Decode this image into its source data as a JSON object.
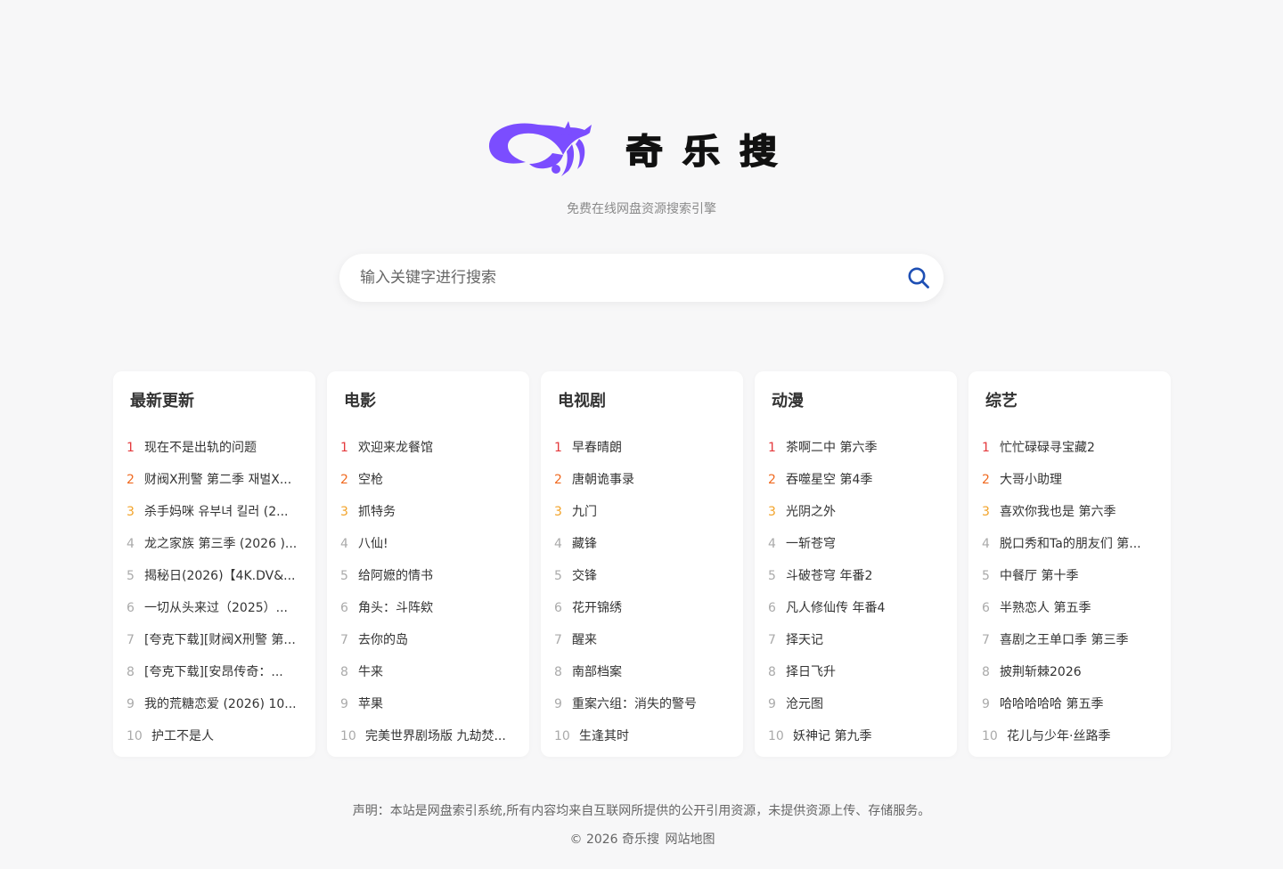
{
  "brand": {
    "name": "奇乐搜",
    "tagline": "免费在线网盘资源搜索引擎",
    "accent_color": "#7b4dff"
  },
  "search": {
    "placeholder": "输入关键字进行搜索",
    "value": "",
    "icon": "search-icon",
    "icon_color": "#1e4fb4"
  },
  "rank_colors": [
    "#e4393c",
    "#f06a20",
    "#f2a329"
  ],
  "sections": [
    {
      "title": "最新更新",
      "items": [
        "现在不是出轨的问题",
        "财阀X刑警 第二季 재벌X...",
        "杀手妈咪 유부녀 킬러 (2...",
        "龙之家族 第三季 (2026 )...",
        "揭秘日(2026)【4K.DV&...",
        "一切从头来过（2025）...",
        "[夸克下载][财阀X刑警 第...",
        "[夸克下载][安昂传奇：...",
        "我的荒糖恋爱 (2026) 10...",
        "护工不是人"
      ]
    },
    {
      "title": "电影",
      "items": [
        "欢迎来龙餐馆",
        "空枪",
        "抓特务",
        "八仙!",
        "给阿嬷的情书",
        "角头：斗阵欸",
        "去你的岛",
        "牛来",
        "苹果",
        "完美世界剧场版 九劫焚..."
      ]
    },
    {
      "title": "电视剧",
      "items": [
        "早春晴朗",
        "唐朝诡事录",
        "九门",
        "藏锋",
        "交锋",
        "花开锦绣",
        "醒来",
        "南部档案",
        "重案六组：消失的警号",
        "生逢其时"
      ]
    },
    {
      "title": "动漫",
      "items": [
        "茶啊二中 第六季",
        "吞噬星空 第4季",
        "光阴之外",
        "一斩苍穹",
        "斗破苍穹 年番2",
        "凡人修仙传 年番4",
        "择天记",
        "择日飞升",
        "沧元图",
        "妖神记 第九季"
      ]
    },
    {
      "title": "综艺",
      "items": [
        "忙忙碌碌寻宝藏2",
        "大哥小助理",
        "喜欢你我也是 第六季",
        "脱口秀和Ta的朋友们 第...",
        "中餐厅 第十季",
        "半熟恋人 第五季",
        "喜剧之王单口季 第三季",
        "披荆斩棘2026",
        "哈哈哈哈哈 第五季",
        "花儿与少年·丝路季"
      ]
    }
  ],
  "footer": {
    "disclaimer": "声明：本站是网盘索引系统,所有内容均来自互联网所提供的公开引用资源，未提供资源上传、存储服务。",
    "copyright": "© 2026 奇乐搜",
    "sitemap_label": "网站地图"
  }
}
